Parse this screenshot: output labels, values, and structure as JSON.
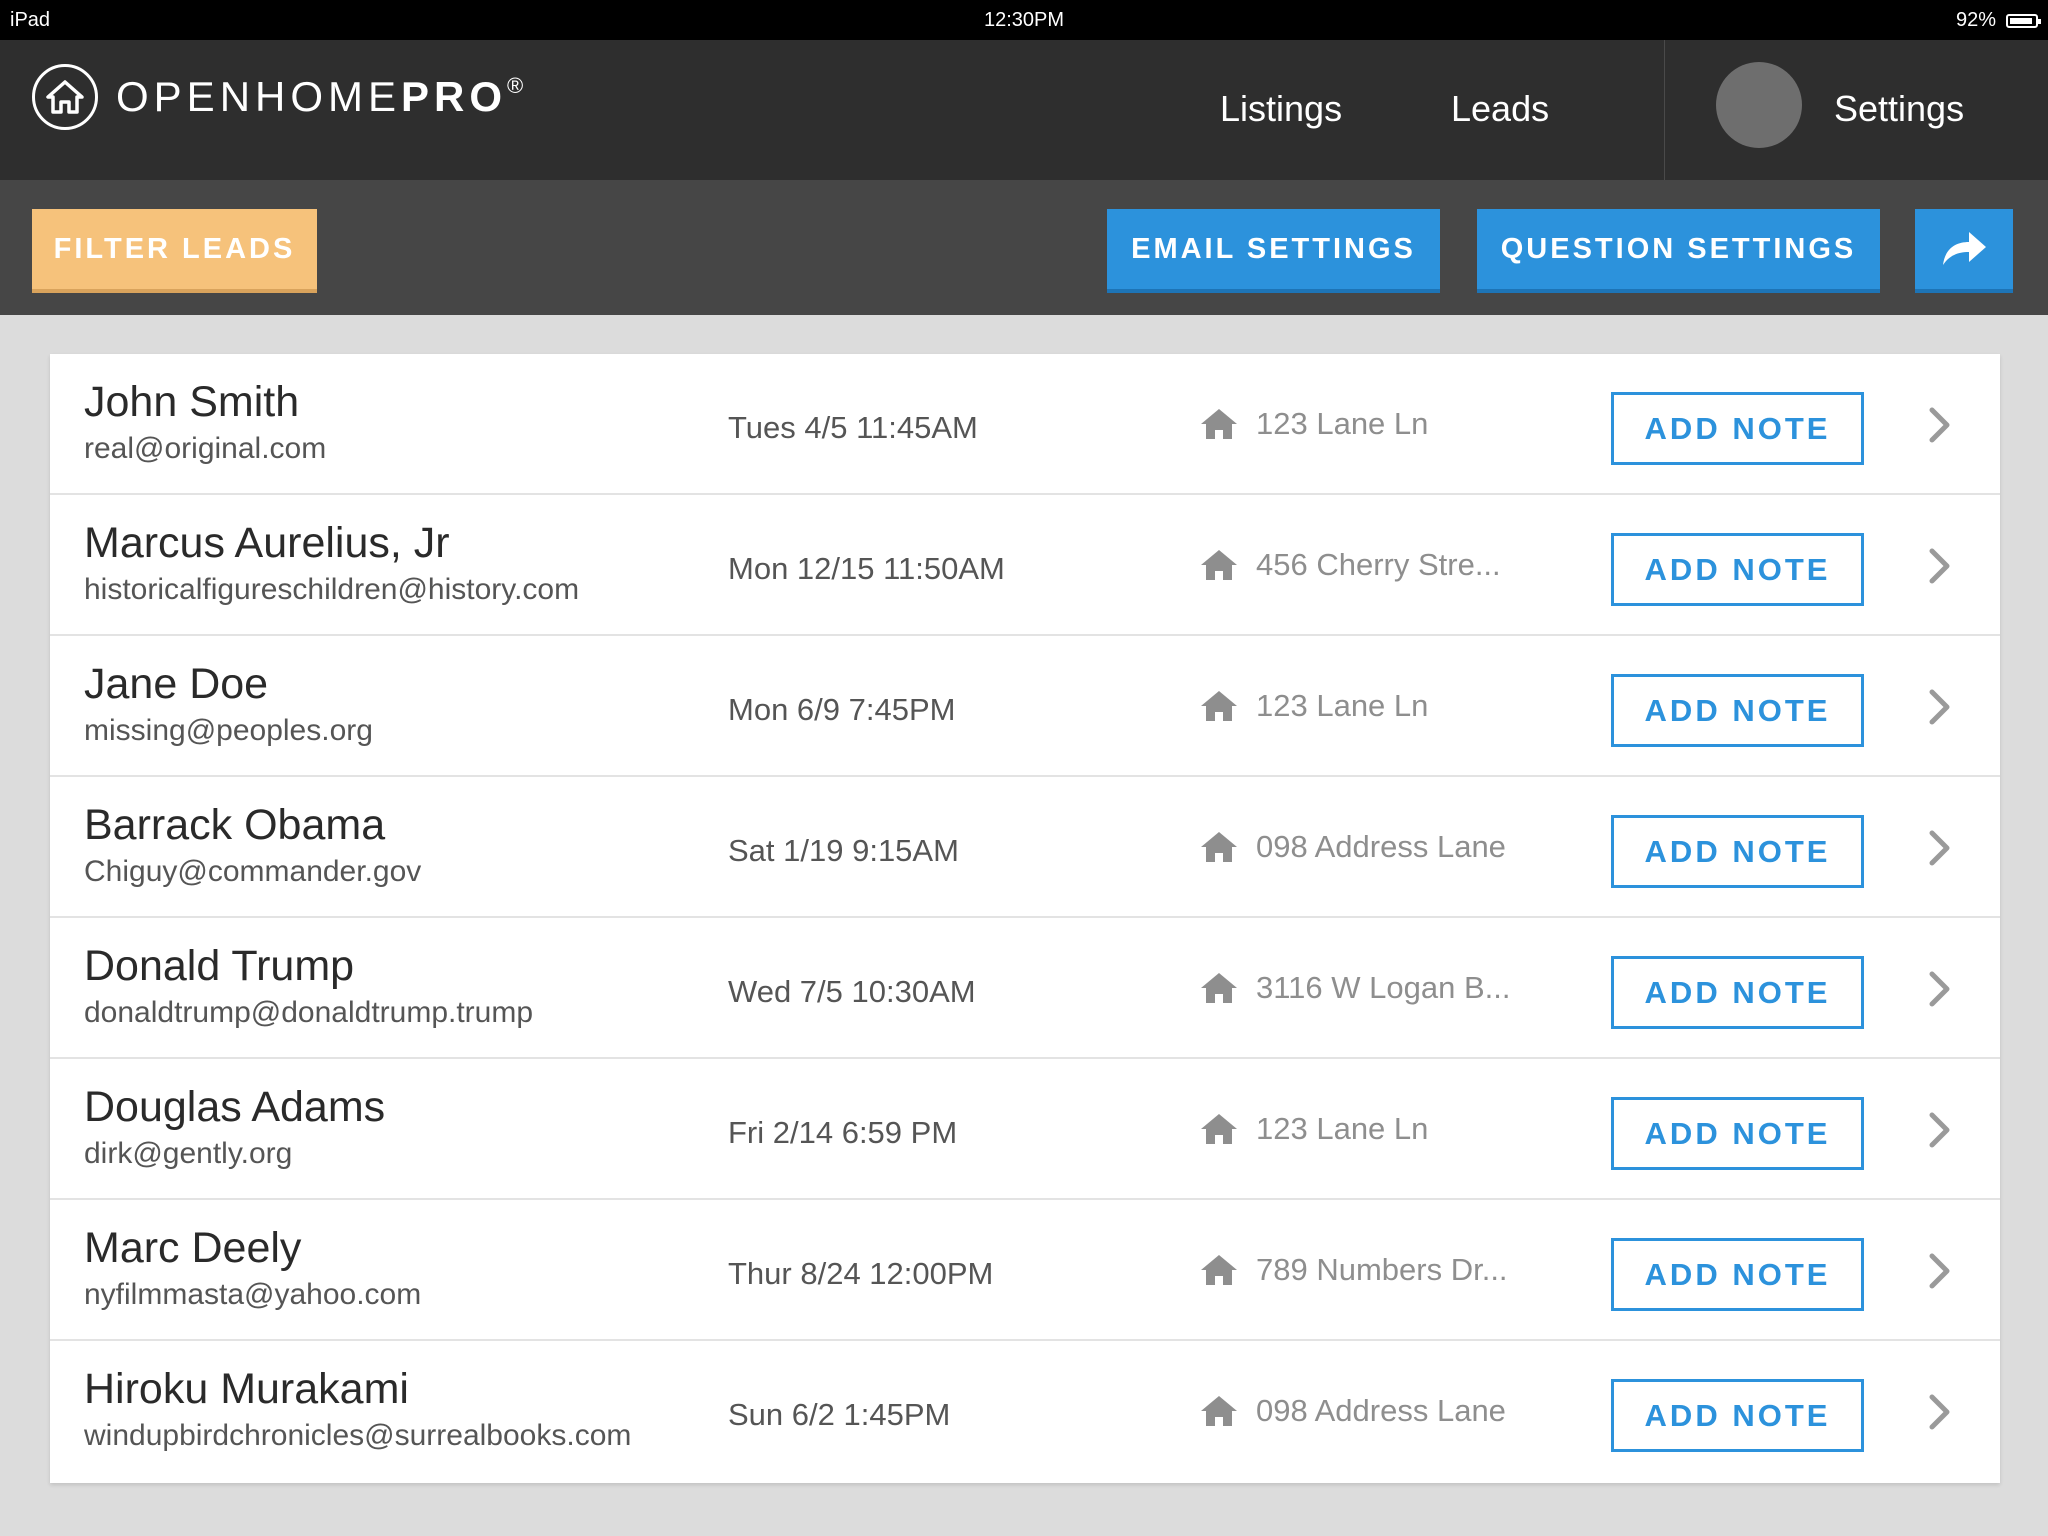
{
  "status_bar": {
    "device": "iPad",
    "time": "12:30PM",
    "battery": "92%",
    "battery_level": 0.92
  },
  "header": {
    "logo_light": "OPENHOME",
    "logo_bold": "PRO",
    "logo_mark": "®",
    "nav": [
      "Listings",
      "Leads",
      "Settings"
    ]
  },
  "toolbar": {
    "filter_label": "FILTER LEADS",
    "email_settings_label": "EMAIL SETTINGS",
    "question_settings_label": "QUESTION SETTINGS",
    "share_icon": "share-arrow-icon"
  },
  "colors": {
    "accent_blue": "#2c92dc",
    "filter_orange": "#f6c27b",
    "nav_bg": "#2e2e2e",
    "toolbar_bg": "#464646"
  },
  "leads": [
    {
      "name": "John Smith",
      "email": "real@original.com",
      "date": "Tues 4/5 11:45AM",
      "address": "123 Lane Ln",
      "action": "ADD NOTE"
    },
    {
      "name": "Marcus Aurelius, Jr",
      "email": "historicalfigureschildren@history.com",
      "date": "Mon 12/15 11:50AM",
      "address": "456 Cherry Stre...",
      "action": "ADD NOTE"
    },
    {
      "name": "Jane Doe",
      "email": "missing@peoples.org",
      "date": "Mon 6/9 7:45PM",
      "address": "123 Lane Ln",
      "action": "ADD NOTE"
    },
    {
      "name": "Barrack Obama",
      "email": "Chiguy@commander.gov",
      "date": "Sat 1/19 9:15AM",
      "address": "098 Address Lane",
      "action": "ADD NOTE"
    },
    {
      "name": "Donald Trump",
      "email": "donaldtrump@donaldtrump.trump",
      "date": "Wed 7/5 10:30AM",
      "address": "3116 W Logan B...",
      "action": "ADD NOTE"
    },
    {
      "name": "Douglas Adams",
      "email": "dirk@gently.org",
      "date": "Fri 2/14 6:59 PM",
      "address": "123 Lane Ln",
      "action": "ADD NOTE"
    },
    {
      "name": "Marc Deely",
      "email": "nyfilmmasta@yahoo.com",
      "date": "Thur 8/24 12:00PM",
      "address": "789 Numbers Dr...",
      "action": "ADD NOTE"
    },
    {
      "name": "Hiroku Murakami",
      "email": "windupbirdchronicles@surrealbooks.com",
      "date": "Sun 6/2 1:45PM",
      "address": "098 Address Lane",
      "action": "ADD NOTE"
    }
  ]
}
